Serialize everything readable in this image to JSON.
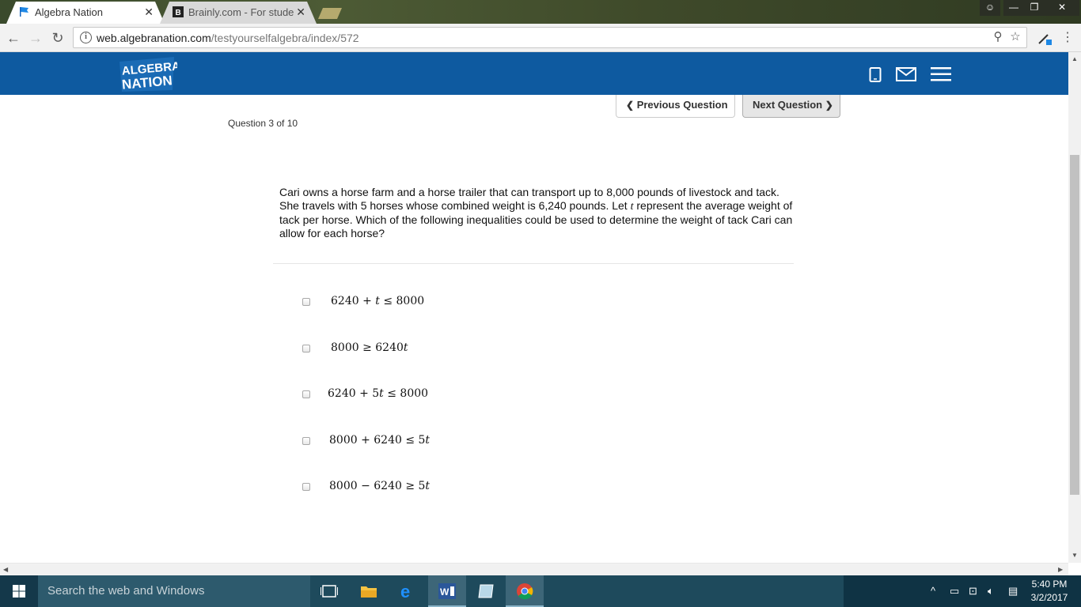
{
  "browser": {
    "tabs": [
      {
        "title": "Algebra Nation",
        "active": true
      },
      {
        "title": "Brainly.com - For studen",
        "active": false
      }
    ],
    "url_host": "web.algebranation.com",
    "url_path": "/testyourselfalgebra/index/572"
  },
  "site": {
    "logo_text_top": "ALGEBRA",
    "logo_text_bottom": "NATION",
    "brand_color": "#0e5aa0"
  },
  "nav": {
    "previous_label": "Previous Question",
    "next_label": "Next Question"
  },
  "question": {
    "counter": "Question 3 of 10",
    "text_part1": "Cari owns a horse farm and a horse trailer that can transport up to 8,000 pounds of livestock and tack. She travels with 5 horses whose combined weight is 6,240 pounds. Let ",
    "variable": "t",
    "text_part2": " represent the average weight of tack per horse. Which of the following inequalities could be used to determine the weight of tack Cari can allow for each horse?"
  },
  "options": [
    {
      "expr": "6240 + 𝑡 ≤ 8000"
    },
    {
      "expr": "8000 ≥ 6240𝑡"
    },
    {
      "expr": "6240 + 5𝑡 ≤ 8000"
    },
    {
      "expr": "8000 + 6240 ≤ 5𝑡"
    },
    {
      "expr": "8000 − 6240 ≥ 5𝑡"
    }
  ],
  "taskbar": {
    "search_placeholder": "Search the web and Windows",
    "time": "5:40 PM",
    "date": "3/2/2017"
  }
}
